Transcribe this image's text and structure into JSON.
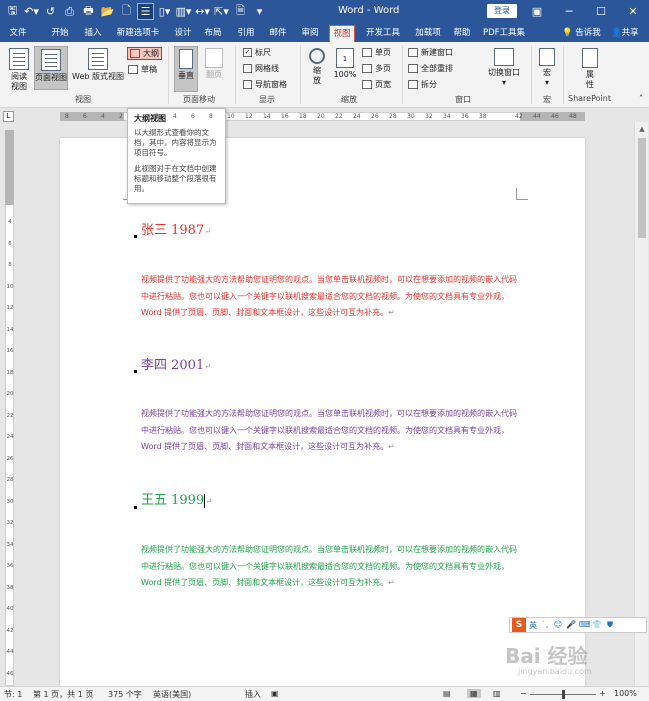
{
  "titlebar": {
    "title": "Word - Word",
    "login_label": "登录",
    "minimize_glyph": "─",
    "maximize_glyph": "☐",
    "close_glyph": "✕",
    "ribbon_display_glyph": "▣"
  },
  "qat": [
    {
      "icon": "save-icon",
      "glyph": "🖫"
    },
    {
      "icon": "undo-icon",
      "glyph": "↶▾"
    },
    {
      "icon": "redo-icon",
      "glyph": "↺"
    },
    {
      "icon": "print-preview-icon",
      "glyph": "⎙"
    },
    {
      "icon": "print-icon",
      "glyph": "🖶"
    },
    {
      "icon": "open-icon",
      "glyph": "📂"
    },
    {
      "icon": "new-icon",
      "glyph": "🗋"
    },
    {
      "icon": "outline-view-icon",
      "glyph": "☰"
    },
    {
      "icon": "draft-icon",
      "glyph": "▯▾"
    },
    {
      "icon": "columns-icon",
      "glyph": "▥▾"
    },
    {
      "icon": "width-icon",
      "glyph": "↔▾"
    },
    {
      "icon": "cursor-icon",
      "glyph": "⇱▾"
    },
    {
      "icon": "doc-icon",
      "glyph": "🗎"
    },
    {
      "icon": "more-icon",
      "glyph": "▾"
    }
  ],
  "tabs": [
    "文件",
    "开始",
    "插入",
    "新建选项卡",
    "设计",
    "布局",
    "引用",
    "邮件",
    "审阅",
    "视图",
    "开发工具",
    "加载项",
    "帮助",
    "PDF工具集"
  ],
  "active_tab": "视图",
  "tellme": "告诉我",
  "share": "共享",
  "ribbon": {
    "groups": {
      "view": "视图",
      "page_move": "页面移动",
      "show": "显示",
      "zoom": "缩放",
      "window": "窗口",
      "macro": "宏",
      "sharepoint": "SharePoint"
    },
    "view": {
      "read_mode": "阅读\n视图",
      "print_layout": "页面视图",
      "web_layout": "Web 版式视图",
      "outline": "大纲",
      "draft": "草稿"
    },
    "page_move": {
      "vertical": "垂直",
      "side_to_side": "翻页"
    },
    "show": {
      "ruler": "标尺",
      "ruler_checked": true,
      "gridlines": "网格线",
      "gridlines_checked": false,
      "nav_pane": "导航窗格",
      "nav_pane_checked": false
    },
    "zoom": {
      "zoom": "缩\n放",
      "hundred": "100%",
      "one_page": "单页",
      "multi_page": "多页",
      "page_width": "页宽"
    },
    "window": {
      "new_window": "新建窗口",
      "arrange_all": "全部重排",
      "split": "拆分",
      "switch_window": "切换窗口"
    },
    "macro": {
      "macros": "宏"
    },
    "sharepoint": {
      "properties": "属\n性"
    }
  },
  "ruler": {
    "ticks": [
      "8",
      "6",
      "4",
      "2",
      "",
      "2",
      "4",
      "6",
      "8",
      "10",
      "12",
      "14",
      "16",
      "18",
      "20",
      "22",
      "24",
      "26",
      "28",
      "30",
      "32",
      "34",
      "36",
      "38",
      "",
      "42",
      "44",
      "46",
      "48"
    ],
    "vticks": [
      "2",
      "",
      "",
      "2",
      "4",
      "6",
      "8",
      "10",
      "12",
      "14",
      "16",
      "18",
      "20",
      "22",
      "24",
      "26",
      "28",
      "30",
      "32",
      "34",
      "36",
      "38",
      "40",
      "42",
      "44",
      "46"
    ]
  },
  "tooltip": {
    "title": "大纲视图",
    "body1": "以大纲形式查看你的文档，其中，内容将显示为项目符号。",
    "body2": "此视图对于在文档中创建标题和移动整个段落很有用。"
  },
  "document": {
    "sections": [
      {
        "heading": "张三 1987",
        "color": "#e8322b",
        "para": "视频提供了功能强大的方法帮助您证明您的观点。当您单击联机视频时，可以在想要添加的视频的嵌入代码中进行粘贴。您也可以键入一个关键字以联机搜索最适合您的文档的视频。为使您的文档具有专业外观，Word 提供了页眉、页脚、封面和文本框设计，这些设计可互为补充。"
      },
      {
        "heading": "李四 2001",
        "color": "#7b3fa6",
        "para": "视频提供了功能强大的方法帮助您证明您的观点。当您单击联机视频时，可以在想要添加的视频的嵌入代码中进行粘贴。您也可以键入一个关键字以联机搜索最适合您的文档的视频。为使您的文档具有专业外观，Word 提供了页眉、页脚、封面和文本框设计，这些设计可互为补充。"
      },
      {
        "heading": "王五 1999",
        "color": "#1fa34a",
        "para": "视频提供了功能强大的方法帮助您证明您的观点。当您单击联机视频时，可以在想要添加的视频的嵌入代码中进行粘贴。您也可以键入一个关键字以联机搜索最适合您的文档的视频。为使您的文档具有专业外观，Word 提供了页眉、页脚、封面和文本框设计，这些设计可互为补充。"
      }
    ],
    "para_mark": "↵"
  },
  "ime": {
    "logo": "S",
    "lang": "英",
    "icons": [
      "˙,",
      "☺",
      "🎤",
      "⌨",
      "👕",
      "⛊"
    ]
  },
  "watermark": {
    "text": "Bai 经验",
    "sub": "jingyan.baidu.com"
  },
  "statusbar": {
    "page": "节: 1",
    "page_count": "第 1 页，共 1 页",
    "words": "375 个字",
    "language": "英语(美国)",
    "insert_mode": "插入",
    "zoom_level": "100%",
    "zoom_minus": "−",
    "zoom_plus": "+"
  },
  "colors": {
    "title_bar": "#2b579a",
    "active_tab_text": "#c23a2b"
  }
}
